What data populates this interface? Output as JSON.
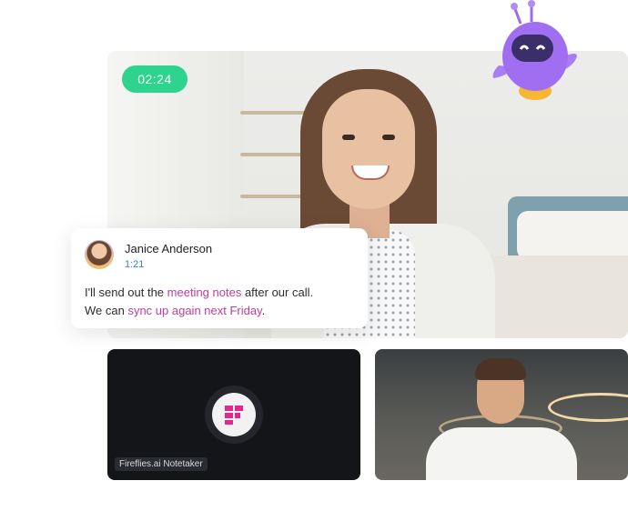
{
  "call": {
    "timer": "02:24"
  },
  "chat": {
    "name": "Janice Anderson",
    "time": "1:21",
    "line1_a": "I'll send out the ",
    "line1_hl": "meeting notes",
    "line1_b": " after our call.",
    "line2_a": "We can ",
    "line2_hl": "sync up again next Friday",
    "line2_b": "."
  },
  "tiles": {
    "notetaker_label": "Fireflies.ai Notetaker"
  },
  "colors": {
    "timer_bg": "#2ed38d",
    "highlight": "#c13d9d",
    "time_link": "#3b7fd4",
    "mascot": "#a06ef0"
  },
  "icons": {
    "mascot": "robot-mascot-icon",
    "notetaker": "fireflies-logo-icon"
  }
}
